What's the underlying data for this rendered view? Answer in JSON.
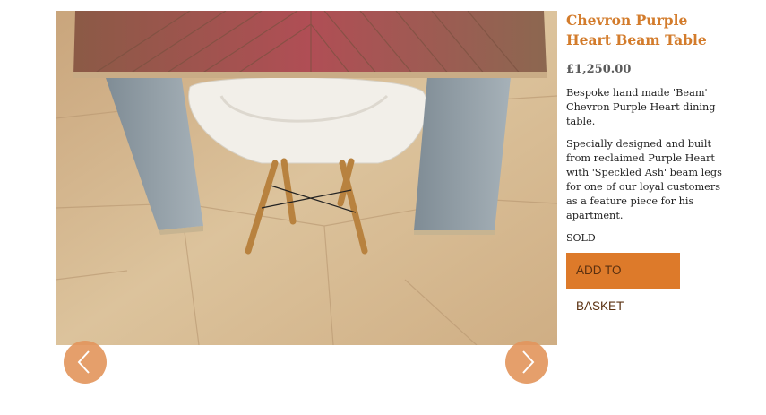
{
  "product": {
    "title": "Chevron Purple Heart Beam Table",
    "price": "£1,250.00",
    "description_1": "Bespoke hand made 'Beam' Chevron Purple Heart dining table.",
    "description_2": "Specially designed and built from reclaimed Purple Heart with 'Speckled Ash' beam legs for one of our loyal customers as a feature piece for his apartment.",
    "status": "SOLD",
    "add_to_basket_label": "ADD TO BASKET"
  },
  "gallery": {
    "prev_icon": "chevron-left-icon",
    "next_icon": "chevron-right-icon"
  },
  "colors": {
    "accent": "#d37c2c",
    "button": "#dd7a2a",
    "arrow": "#e3955c"
  }
}
